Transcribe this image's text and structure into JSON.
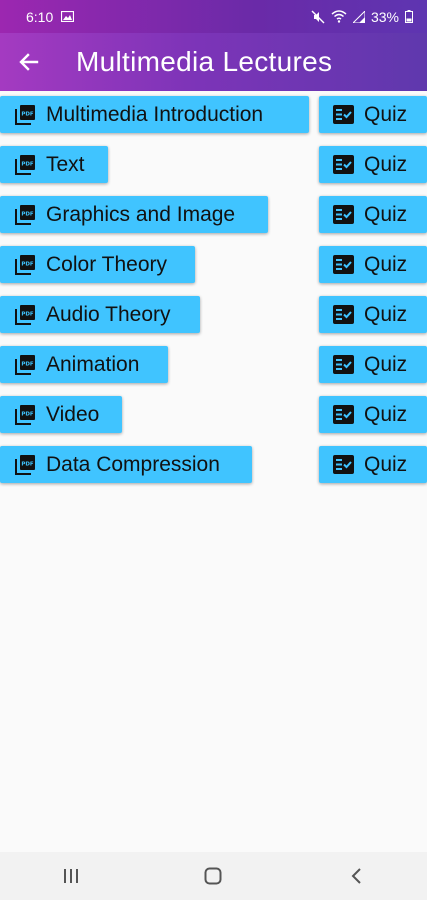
{
  "status_bar": {
    "time": "6:10",
    "battery": "33%"
  },
  "app_bar": {
    "title": "Multimedia Lectures"
  },
  "lectures": [
    {
      "label": "Multimedia Introduction",
      "quiz_label": "Quiz"
    },
    {
      "label": "Text",
      "quiz_label": "Quiz"
    },
    {
      "label": "Graphics and Image",
      "quiz_label": "Quiz"
    },
    {
      "label": "Color Theory",
      "quiz_label": "Quiz"
    },
    {
      "label": "Audio Theory",
      "quiz_label": "Quiz"
    },
    {
      "label": "Animation",
      "quiz_label": "Quiz"
    },
    {
      "label": "Video",
      "quiz_label": "Quiz"
    },
    {
      "label": "Data Compression",
      "quiz_label": "Quiz"
    }
  ],
  "icons": {
    "lecture_icon": "picture-as-pdf-icon",
    "quiz_icon": "fact-check-icon"
  },
  "colors": {
    "button": "#40c4ff",
    "app_bar_start": "#a43ac1",
    "app_bar_end": "#5f38ad"
  }
}
